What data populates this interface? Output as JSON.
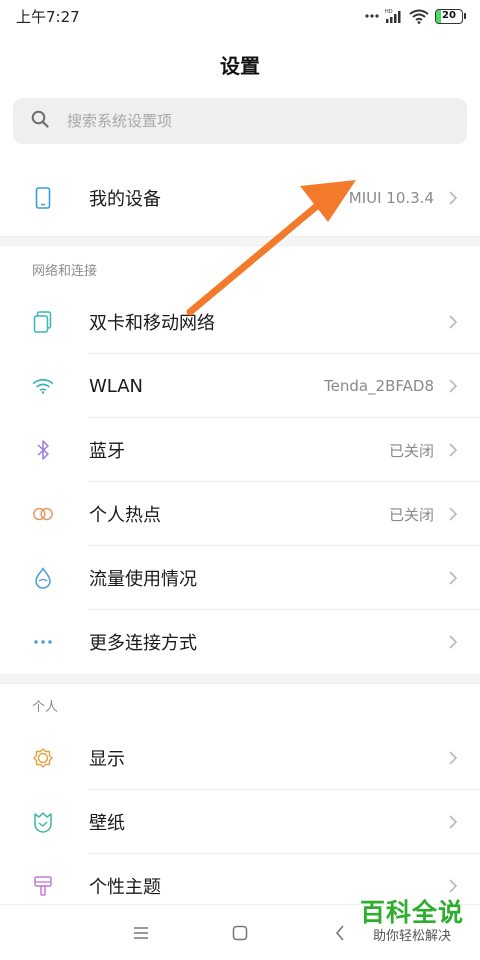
{
  "status_bar": {
    "time": "上午7:27",
    "battery": "20",
    "battery_level": 0.2
  },
  "header": {
    "title": "设置"
  },
  "search": {
    "placeholder": "搜索系统设置项",
    "icon": "search-icon"
  },
  "device": {
    "label": "我的设备",
    "value": "MIUI 10.3.4",
    "icon": "phone-icon"
  },
  "sections": [
    {
      "header": "网络和连接",
      "items": [
        {
          "label": "双卡和移动网络",
          "value": "",
          "icon": "sim-card-icon",
          "color": "#3bb6b0"
        },
        {
          "label": "WLAN",
          "value": "Tenda_2BFAD8",
          "icon": "wifi-icon",
          "color": "#3bb6b0"
        },
        {
          "label": "蓝牙",
          "value": "已关闭",
          "icon": "bluetooth-icon",
          "color": "#9b7be0"
        },
        {
          "label": "个人热点",
          "value": "已关闭",
          "icon": "hotspot-icon",
          "color": "#e8915a"
        },
        {
          "label": "流量使用情况",
          "value": "",
          "icon": "data-usage-icon",
          "color": "#4a9ed8"
        },
        {
          "label": "更多连接方式",
          "value": "",
          "icon": "more-icon",
          "color": "#4a9ed8"
        }
      ]
    },
    {
      "header": "个人",
      "items": [
        {
          "label": "显示",
          "value": "",
          "icon": "sun-icon",
          "color": "#e8a040"
        },
        {
          "label": "壁纸",
          "value": "",
          "icon": "wallpaper-icon",
          "color": "#3bb6a0"
        },
        {
          "label": "个性主题",
          "value": "",
          "icon": "theme-brush-icon",
          "color": "#c07ad8"
        }
      ]
    }
  ],
  "nav_bar": {
    "menu_icon": "menu-icon",
    "home_icon": "home-icon",
    "back_icon": "back-icon"
  },
  "watermark": {
    "title": "百科全说",
    "subtitle": "助你轻松解决"
  },
  "colors": {
    "accent_arrow": "#f27a2a",
    "chevron": "#b8b8b8",
    "device_icon": "#3a9ed8"
  }
}
